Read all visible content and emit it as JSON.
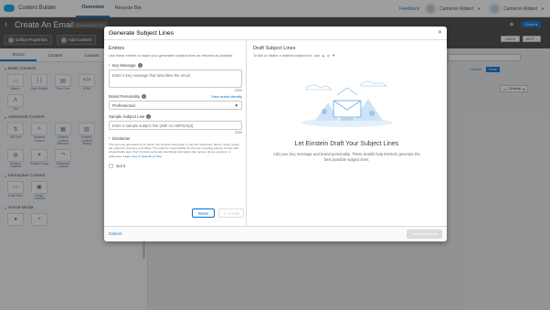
{
  "topbar": {
    "app_name": "Content Builder",
    "tabs": [
      {
        "label": "Overview",
        "active": true
      },
      {
        "label": "Recycle Bin",
        "active": false
      }
    ],
    "feedback": "Feedback",
    "user1": "Cameron Robert",
    "user2": "Cameron Robert"
  },
  "header": {
    "title": "Create An Email",
    "badge": "Generated AI Text",
    "define_properties": "Define Properties",
    "add_content": "Add Content",
    "done": "Done",
    "back": "BACK",
    "next": "NEXT"
  },
  "left_panel": {
    "tabs": [
      "Blocks",
      "Content",
      "Layouts",
      "Sa..."
    ],
    "sections": [
      {
        "title": "Basic Content",
        "rows": [
          [
            {
              "label": "Button",
              "icon": "button-icon",
              "glyph": "▭"
            },
            {
              "label": "Code Snippet",
              "icon": "code-icon",
              "glyph": "{ }"
            },
            {
              "label": "Free Form",
              "icon": "freeform-icon",
              "glyph": "▤"
            },
            {
              "label": "HTML",
              "icon": "html-icon",
              "glyph": "</>"
            }
          ],
          [
            {
              "label": "Text",
              "icon": "text-icon",
              "glyph": "A"
            }
          ]
        ]
      },
      {
        "title": "Advanced Content",
        "rows": [
          [
            {
              "label": "A/B Test",
              "icon": "ab-test-icon",
              "glyph": "⇅"
            },
            {
              "label": "Dynamic Content",
              "icon": "dynamic-content-icon",
              "glyph": "⟡"
            },
            {
              "label": "Einstein Content Selection",
              "icon": "einstein-selection-icon",
              "glyph": "▦"
            },
            {
              "label": "Einstein Content Testing",
              "icon": "einstein-testing-icon",
              "glyph": "▥"
            }
          ],
          [
            {
              "label": "Einstein Content",
              "icon": "einstein-content-icon",
              "glyph": "◍"
            },
            {
              "label": "Einstein Copy",
              "icon": "einstein-copy-icon",
              "glyph": "✦"
            },
            {
              "label": "Reference Content",
              "icon": "reference-content-icon",
              "glyph": "⤳"
            }
          ]
        ]
      },
      {
        "title": "Interactive Content",
        "rows": [
          [
            {
              "label": "Email Form",
              "icon": "email-form-icon",
              "glyph": "▭"
            },
            {
              "label": "Image Carousel",
              "icon": "image-carousel-icon",
              "glyph": "▣"
            }
          ]
        ]
      },
      {
        "title": "Social Media",
        "rows": [
          [
            {
              "label": "",
              "icon": "social-follow-icon",
              "glyph": "●"
            },
            {
              "label": "",
              "icon": "social-share-icon",
              "glyph": "<"
            }
          ]
        ]
      }
    ]
  },
  "canvas": {
    "cancel": "Cancel",
    "done": "Done",
    "desktop": "Desktop"
  },
  "modal": {
    "title": "Generate Subject Lines",
    "left": {
      "heading": "Entries",
      "description": "Use these entries to make your generated subject lines as relevant as possible.",
      "key_message_label": "Key Message",
      "key_message_placeholder": "Enter a key message that describes the email.",
      "key_message_counter": "0/200",
      "brand_personality_label": "Brand Personality",
      "brand_identity_link": "View brand identity",
      "brand_personality_value": "Professional",
      "sample_label": "Sample Subject Line",
      "sample_placeholder": "Enter a sample subject line (with no AMPScript).",
      "sample_counter": "0/150",
      "disclaimer_label": "Disclaimer",
      "disclaimer_text": "This text was generated by AI, which can produce inaccurate or harmful responses. Before using, review the output for accuracy and safety. The outcome responsibility for the user ensuring outputs comply with all applicable laws. Don't include personally identifying information like names, phone numbers, or addresses.",
      "disclaimer_link": "Learn more in Salesforce Help.",
      "checkbox_label": "Got it",
      "reset": "Reset",
      "create": "Create"
    },
    "right": {
      "heading": "Draft Subject Lines",
      "subtext": "To like or dislike a drafted subject line, use",
      "empty_title": "Let Einstein Draft Your Subject Lines",
      "empty_sub": "Add your key message and brand personality. These details help Einstein generate the best possible subject lines."
    },
    "footer": {
      "cancel": "Cancel",
      "add": "Add Subject Line"
    }
  }
}
